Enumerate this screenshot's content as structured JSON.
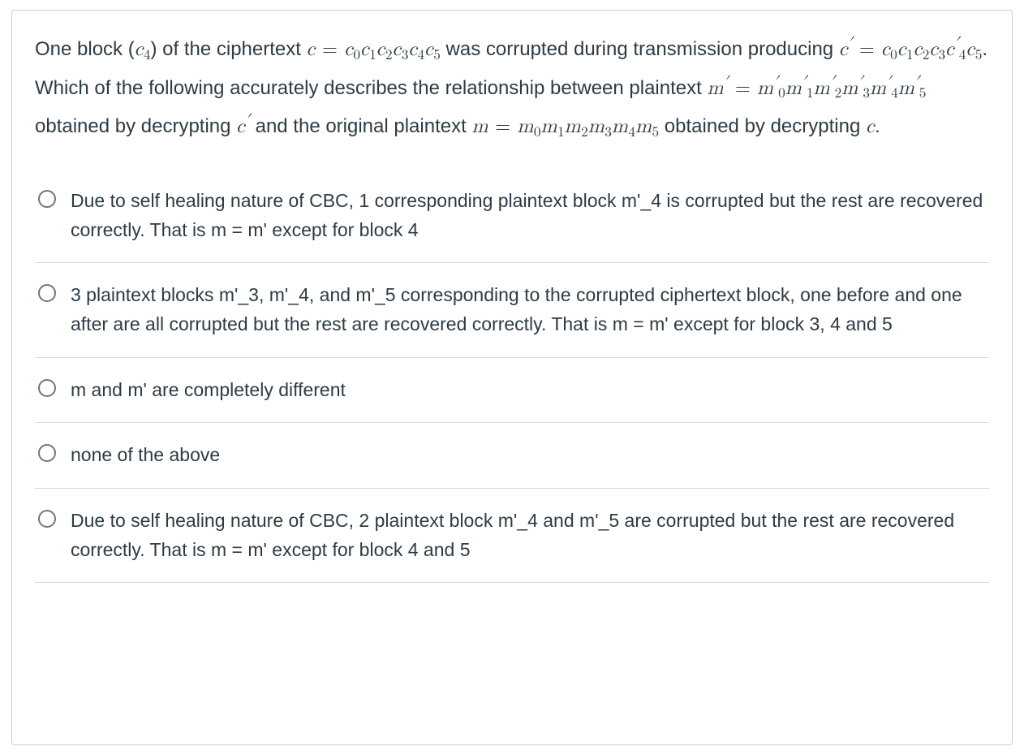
{
  "question": {
    "p1_a": "One block (",
    "p1_b": ") of the ciphertext ",
    "p1_c": " was corrupted during transmission producing ",
    "p1_d": ". Which of the following accurately describes the relationship between plaintext ",
    "p1_e": " obtained by decrypting ",
    "p1_f": " and the original plaintext ",
    "p1_g": " obtained by decrypting ",
    "p1_h": ".",
    "sym_c4": "c",
    "sym_c4_sub": "4",
    "sym_c": "c",
    "sym_eq": "=",
    "sym_cprime": "c",
    "sym_prime": "′",
    "sym_m": "m",
    "sym_mprime": "m",
    "blocks_c": [
      "0",
      "1",
      "2",
      "3",
      "4",
      "5"
    ],
    "blocks_cprime": [
      "0",
      "1",
      "2",
      "3",
      "4",
      "5"
    ],
    "cprime_corrupt_index": "4",
    "blocks_mprime": [
      "0",
      "1",
      "2",
      "3",
      "4",
      "5"
    ],
    "blocks_m": [
      "0",
      "1",
      "2",
      "3",
      "4",
      "5"
    ]
  },
  "answers": [
    "Due to self healing nature of CBC, 1 corresponding plaintext block m'_4 is corrupted but the rest are recovered correctly. That is m = m' except for block 4",
    "3 plaintext blocks m'_3, m'_4, and m'_5 corresponding to the corrupted ciphertext block, one before and one after are all corrupted but the rest are recovered correctly. That is m = m' except for block 3, 4 and 5",
    "m and m' are completely different",
    "none of the above",
    "Due to self healing nature of CBC, 2 plaintext block m'_4 and m'_5 are corrupted but the rest are recovered correctly. That is m = m' except for block 4 and 5"
  ]
}
